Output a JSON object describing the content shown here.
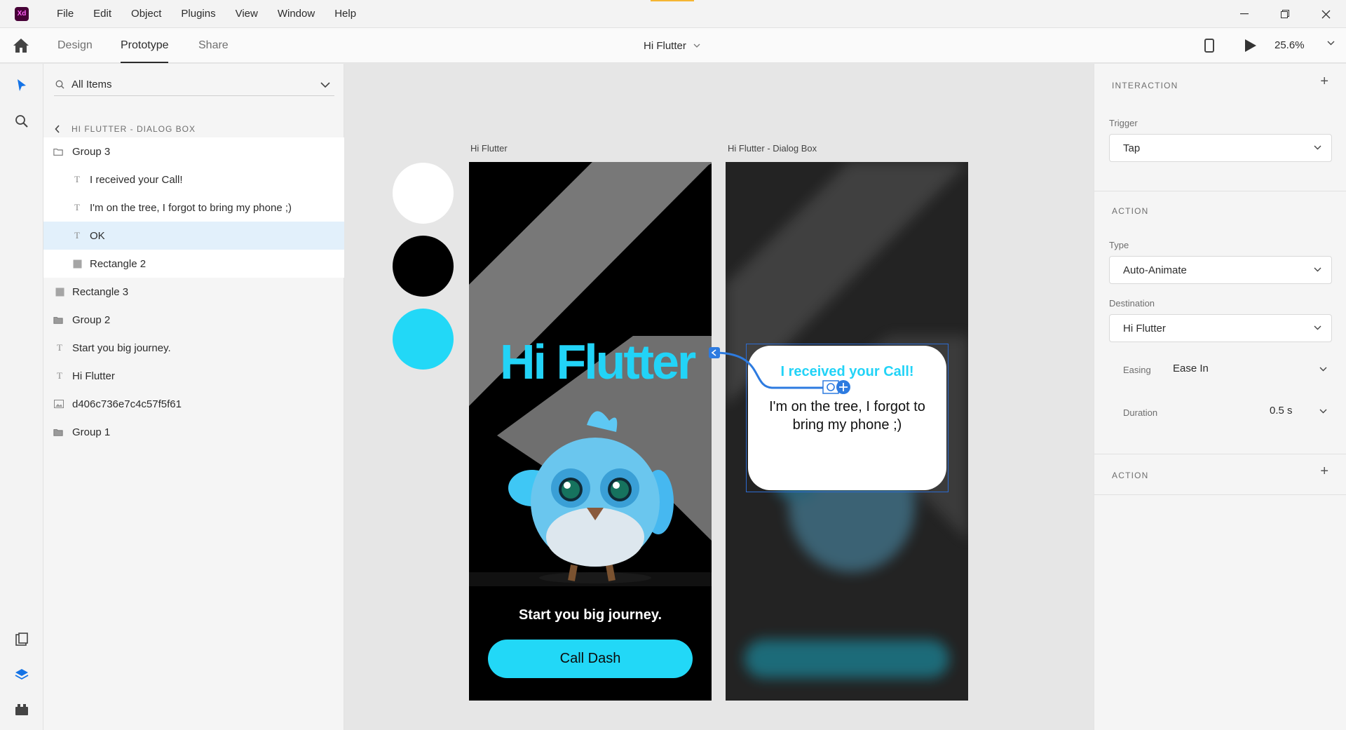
{
  "menubar": {
    "app_logo": "Xd",
    "items": [
      "File",
      "Edit",
      "Object",
      "Plugins",
      "View",
      "Window",
      "Help"
    ]
  },
  "tabs": {
    "items": [
      "Design",
      "Prototype",
      "Share"
    ],
    "active": "Prototype",
    "document_title": "Hi Flutter",
    "zoom": "25.6%"
  },
  "layers": {
    "search_placeholder": "All Items",
    "breadcrumb": "HI FLUTTER - DIALOG BOX",
    "items": [
      {
        "label": "Group 3",
        "icon": "folder-icon"
      },
      {
        "label": "I received your Call!",
        "icon": "text-icon"
      },
      {
        "label": "I'm on the tree, I forgot  to bring my phone ;)",
        "icon": "text-icon"
      },
      {
        "label": "OK",
        "icon": "text-icon"
      },
      {
        "label": "Rectangle 2",
        "icon": "rectangle-icon"
      },
      {
        "label": "Rectangle 3",
        "icon": "rectangle-icon"
      },
      {
        "label": "Group 2",
        "icon": "folder-icon"
      },
      {
        "label": "Start you big journey.",
        "icon": "text-icon"
      },
      {
        "label": "Hi Flutter",
        "icon": "text-icon"
      },
      {
        "label": "d406c736e7c4c57f5f61",
        "icon": "image-icon"
      },
      {
        "label": "Group 1",
        "icon": "folder-icon"
      }
    ]
  },
  "canvas": {
    "swatches": [
      "#ffffff",
      "#000000",
      "#22d8f7"
    ],
    "artboard1": {
      "label": "Hi Flutter",
      "title": "Hi Flutter",
      "tagline": "Start you big journey.",
      "button": "Call Dash"
    },
    "artboard2": {
      "label": "Hi Flutter - Dialog Box",
      "dialog_title": "I received your Call!",
      "dialog_message": "I'm on the tree, I forgot to bring my phone ;)"
    }
  },
  "properties": {
    "interaction": {
      "title": "INTERACTION",
      "trigger_label": "Trigger",
      "trigger_value": "Tap"
    },
    "action": {
      "title": "ACTION",
      "type_label": "Type",
      "type_value": "Auto-Animate",
      "destination_label": "Destination",
      "destination_value": "Hi Flutter",
      "easing_label": "Easing",
      "easing_value": "Ease In",
      "duration_label": "Duration",
      "duration_value": "0.5 s"
    },
    "action2": {
      "title": "ACTION"
    }
  },
  "colors": {
    "accent": "#22d8f7",
    "wire": "#2d7be0"
  }
}
